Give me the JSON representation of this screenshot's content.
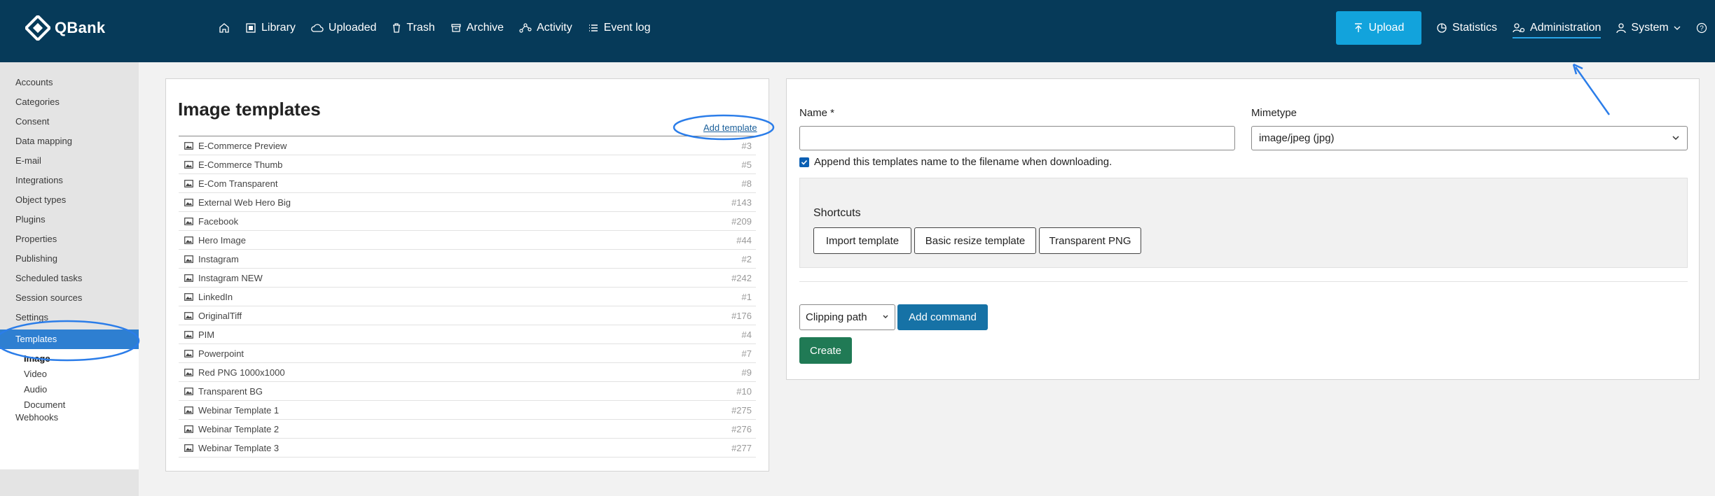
{
  "app": {
    "brand": "QBank"
  },
  "nav": {
    "items": [
      {
        "icon": "home-icon",
        "label": ""
      },
      {
        "icon": "library-icon",
        "label": "Library"
      },
      {
        "icon": "cloud-icon",
        "label": "Uploaded"
      },
      {
        "icon": "trash-icon",
        "label": "Trash"
      },
      {
        "icon": "archive-icon",
        "label": "Archive"
      },
      {
        "icon": "activity-icon",
        "label": "Activity"
      },
      {
        "icon": "list-icon",
        "label": "Event log"
      }
    ],
    "upload_label": "Upload",
    "statistics_label": "Statistics",
    "administration_label": "Administration",
    "system_label": "System"
  },
  "sidebar": {
    "items": [
      "Accounts",
      "Categories",
      "Consent",
      "Data mapping",
      "E-mail",
      "Integrations",
      "Object types",
      "Plugins",
      "Properties",
      "Publishing",
      "Scheduled tasks",
      "Session sources",
      "Settings"
    ],
    "active": "Templates",
    "sub_items": [
      "Image",
      "Video",
      "Audio",
      "Document"
    ],
    "after": "Webhooks"
  },
  "templates": {
    "title": "Image templates",
    "add_label": "Add template",
    "rows": [
      {
        "name": "E-Commerce Preview",
        "id": "#3"
      },
      {
        "name": "E-Commerce Thumb",
        "id": "#5"
      },
      {
        "name": "E-Com Transparent",
        "id": "#8"
      },
      {
        "name": "External Web Hero Big",
        "id": "#143"
      },
      {
        "name": "Facebook",
        "id": "#209"
      },
      {
        "name": "Hero Image",
        "id": "#44"
      },
      {
        "name": "Instagram",
        "id": "#2"
      },
      {
        "name": "Instagram NEW",
        "id": "#242"
      },
      {
        "name": "LinkedIn",
        "id": "#1"
      },
      {
        "name": "OriginalTiff",
        "id": "#176"
      },
      {
        "name": "PIM",
        "id": "#4"
      },
      {
        "name": "Powerpoint",
        "id": "#7"
      },
      {
        "name": "Red PNG 1000x1000",
        "id": "#9"
      },
      {
        "name": "Transparent BG",
        "id": "#10"
      },
      {
        "name": "Webinar Template 1",
        "id": "#275"
      },
      {
        "name": "Webinar Template 2",
        "id": "#276"
      },
      {
        "name": "Webinar Template 3",
        "id": "#277"
      }
    ]
  },
  "form": {
    "name_label": "Name *",
    "name_value": "",
    "mimetype_label": "Mimetype",
    "mimetype_value": "image/jpeg (jpg)",
    "append_label": "Append this templates name to the filename when downloading.",
    "append_checked": true,
    "shortcuts_title": "Shortcuts",
    "shortcuts": [
      "Import template",
      "Basic resize template",
      "Transparent PNG"
    ],
    "command_select": "Clipping path",
    "add_command_label": "Add command",
    "create_label": "Create"
  },
  "colors": {
    "topbar": "#063a59",
    "upload": "#12a3dc",
    "active_side": "#2e7fd1",
    "annotation": "#2b7de9",
    "create": "#207a55"
  }
}
